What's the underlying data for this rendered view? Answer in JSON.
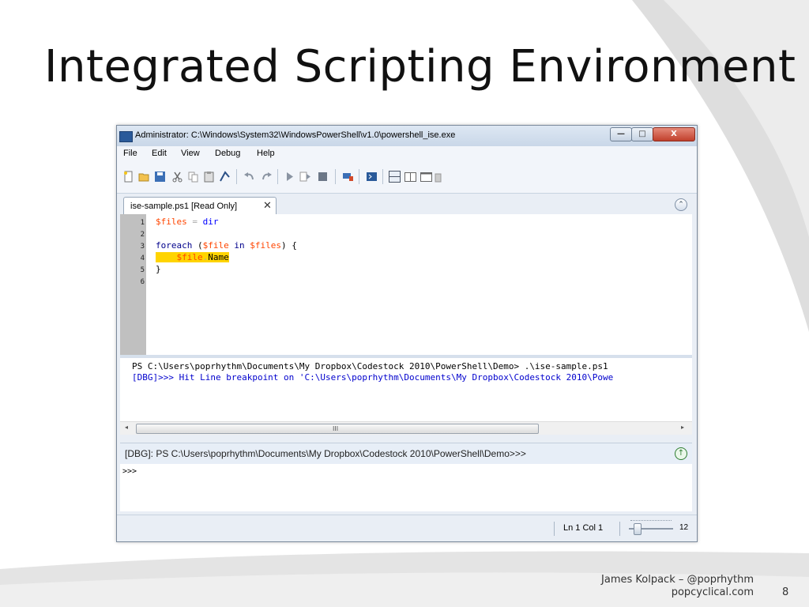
{
  "slide": {
    "title": "Integrated Scripting Environment",
    "footer_author": "James Kolpack – @poprhythm",
    "footer_site": "popcyclical.com",
    "number": "8"
  },
  "window": {
    "title": "Administrator: C:\\Windows\\System32\\WindowsPowerShell\\v1.0\\powershell_ise.exe",
    "controls": {
      "minimize": "—",
      "maximize": "□",
      "close": "X"
    }
  },
  "menu": [
    "File",
    "Edit",
    "View",
    "Debug",
    "Help"
  ],
  "toolbar": {
    "icons": [
      "new-icon",
      "open-icon",
      "save-icon",
      "cut-icon",
      "copy-icon",
      "paste-icon",
      "clear-icon",
      "undo-icon",
      "redo-icon",
      "run-icon",
      "run-selection-icon",
      "stop-icon",
      "remote-icon",
      "powershell-icon",
      "layout-top-icon",
      "layout-right-icon",
      "layout-max-icon",
      "expand-icon"
    ]
  },
  "tab": {
    "label": "ise-sample.ps1 [Read Only]",
    "close": "✕",
    "collapse": "⌃"
  },
  "editor": {
    "line_numbers": [
      "1",
      "2",
      "3",
      "4",
      "5",
      "6"
    ],
    "lines": {
      "l1": {
        "var": "$files",
        "op": " = ",
        "cmd": "dir"
      },
      "l3": {
        "kw": "foreach",
        "p1": " (",
        "var1": "$file",
        "in": " in ",
        "var2": "$files",
        "p2": ") {"
      },
      "l4": {
        "indent": "    ",
        "var": "$file",
        "dot": ".",
        "prop": "Name"
      },
      "l5": {
        "brace": "}"
      }
    }
  },
  "output": {
    "line1": "PS C:\\Users\\poprhythm\\Documents\\My Dropbox\\Codestock 2010\\PowerShell\\Demo> .\\ise-sample.ps1",
    "line2": "[DBG]>>> Hit Line breakpoint on 'C:\\Users\\poprhythm\\Documents\\My Dropbox\\Codestock 2010\\Powe"
  },
  "scrollbar": {
    "left": "◂",
    "right": "▸",
    "grip": "III"
  },
  "command": {
    "prompt": "[DBG]: PS C:\\Users\\poprhythm\\Documents\\My Dropbox\\Codestock 2010\\PowerShell\\Demo>>>",
    "input": ">>>",
    "run": "↑"
  },
  "status": {
    "position": "Ln 1  Col 1",
    "zoom": "12"
  },
  "colors": {
    "keyword": "#00008b",
    "variable": "#ff4500",
    "command": "#0000ff",
    "debug_text": "#0000cd",
    "breakpoint": "#ffd400"
  }
}
